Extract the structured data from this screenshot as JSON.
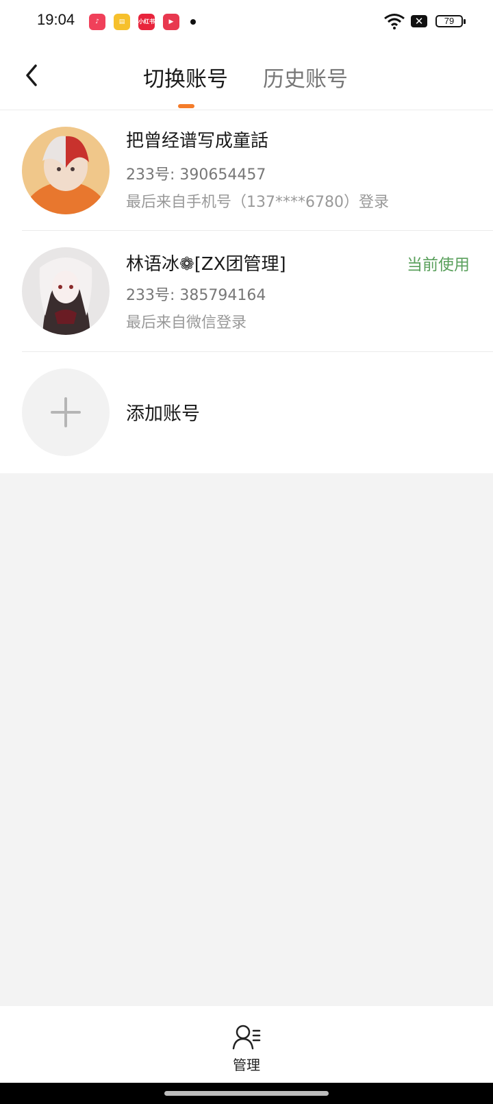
{
  "status_bar": {
    "time": "19:04",
    "notification_icons": [
      "music-icon",
      "notes-icon",
      "xiaohongshu-icon",
      "video-icon"
    ],
    "xiaohongshu_text": "小红书",
    "battery": "79"
  },
  "header": {
    "tabs": [
      {
        "label": "切换账号",
        "active": true
      },
      {
        "label": "历史账号",
        "active": false
      }
    ],
    "accent_color": "#f47c2a"
  },
  "accounts": [
    {
      "name": "把曾经谱写成童話",
      "id_line": "233号: 390654457",
      "login_line": "最后来自手机号（137****6780）登录",
      "current": false
    },
    {
      "name": "林语冰❁[ZX团管理]",
      "id_line": "233号: 385794164",
      "login_line": "最后来自微信登录",
      "current": true,
      "current_label": "当前使用"
    }
  ],
  "add_account": {
    "label": "添加账号"
  },
  "bottom_bar": {
    "manage_label": "管理"
  }
}
